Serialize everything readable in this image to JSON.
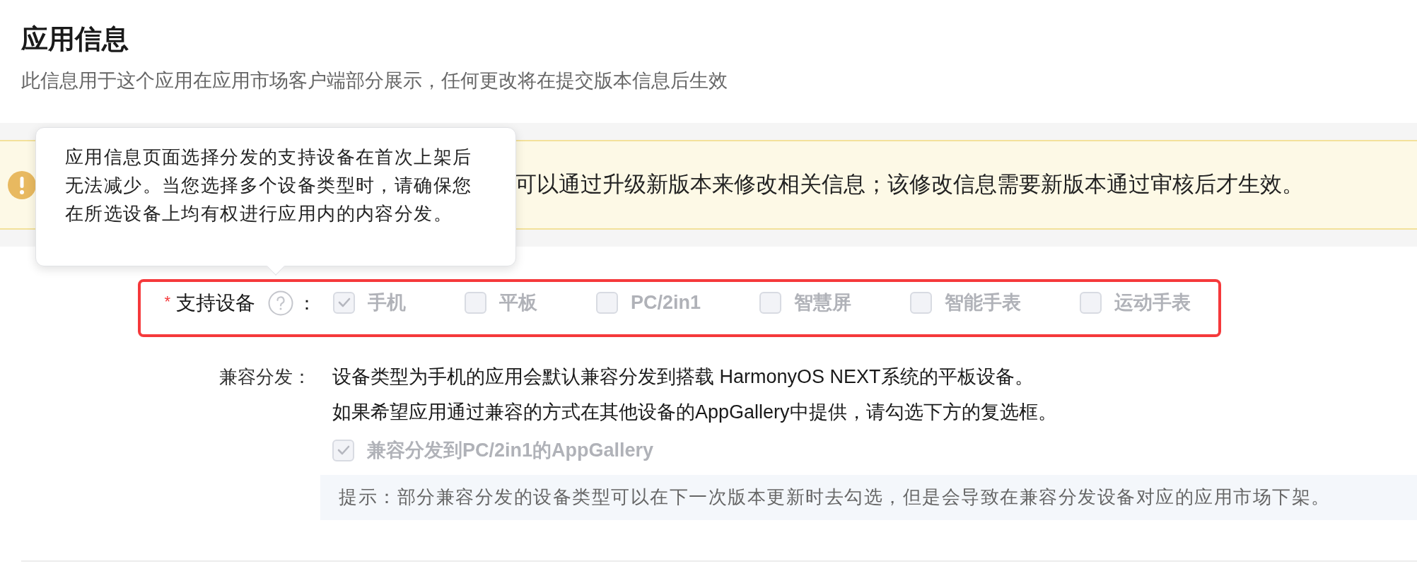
{
  "header": {
    "title": "应用信息",
    "subtitle": "此信息用于这个应用在应用市场客户端部分展示，任何更改将在提交版本信息后生效"
  },
  "notice": {
    "text": "可以通过升级新版本来修改相关信息；该修改信息需要新版本通过审核后才生效。"
  },
  "tooltip": {
    "text": "应用信息页面选择分发的支持设备在首次上架后无法减少。当您选择多个设备类型时，请确保您在所选设备上均有权进行应用内的内容分发。"
  },
  "supported_devices": {
    "required_mark": "*",
    "label": "支持设备",
    "suffix": "：",
    "highlighted": true,
    "options": [
      {
        "label": "手机",
        "checked": true,
        "disabled": true
      },
      {
        "label": "平板",
        "checked": false,
        "disabled": true
      },
      {
        "label": "PC/2in1",
        "checked": false,
        "disabled": true
      },
      {
        "label": "智慧屏",
        "checked": false,
        "disabled": true
      },
      {
        "label": "智能手表",
        "checked": false,
        "disabled": true
      },
      {
        "label": "运动手表",
        "checked": false,
        "disabled": true
      }
    ]
  },
  "compatible_distribution": {
    "label": "兼容分发：",
    "lines": [
      "设备类型为手机的应用会默认兼容分发到搭载 HarmonyOS NEXT系统的平板设备。",
      "如果希望应用通过兼容的方式在其他设备的AppGallery中提供，请勾选下方的复选框。"
    ],
    "option": {
      "label": "兼容分发到PC/2in1的AppGallery",
      "checked": true,
      "disabled": true
    },
    "hint": "提示：部分兼容分发的设备类型可以在下一次版本更新时去勾选，但是会导致在兼容分发设备对应的应用市场下架。"
  }
}
